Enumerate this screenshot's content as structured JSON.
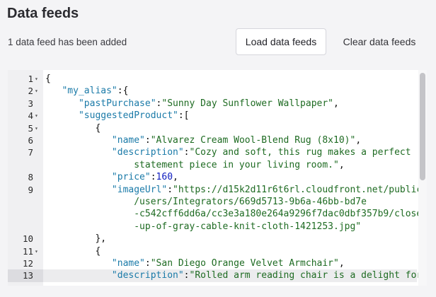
{
  "header": {
    "title": "Data feeds",
    "status": "1 data feed has been added",
    "load_button": "Load data feeds",
    "clear_button": "Clear data feeds"
  },
  "editor": {
    "lines": [
      {
        "num": "1",
        "fold": true,
        "parts": [
          {
            "t": "{",
            "c": "p"
          }
        ]
      },
      {
        "num": "2",
        "fold": true,
        "parts": [
          {
            "t": "   ",
            "c": "p"
          },
          {
            "t": "\"my_alias\"",
            "c": "k"
          },
          {
            "t": ":{",
            "c": "p"
          }
        ]
      },
      {
        "num": "3",
        "fold": false,
        "parts": [
          {
            "t": "      ",
            "c": "p"
          },
          {
            "t": "\"pastPurchase\"",
            "c": "k"
          },
          {
            "t": ":",
            "c": "p"
          },
          {
            "t": "\"Sunny Day Sunflower Wallpaper\"",
            "c": "s"
          },
          {
            "t": ",",
            "c": "p"
          }
        ]
      },
      {
        "num": "4",
        "fold": true,
        "parts": [
          {
            "t": "      ",
            "c": "p"
          },
          {
            "t": "\"suggestedProduct\"",
            "c": "k"
          },
          {
            "t": ":[",
            "c": "p"
          }
        ]
      },
      {
        "num": "5",
        "fold": true,
        "parts": [
          {
            "t": "         {",
            "c": "p"
          }
        ]
      },
      {
        "num": "6",
        "fold": false,
        "parts": [
          {
            "t": "            ",
            "c": "p"
          },
          {
            "t": "\"name\"",
            "c": "k"
          },
          {
            "t": ":",
            "c": "p"
          },
          {
            "t": "\"Alvarez Cream Wool-Blend Rug (8x10)\"",
            "c": "s"
          },
          {
            "t": ",",
            "c": "p"
          }
        ]
      },
      {
        "num": "7",
        "fold": false,
        "parts": [
          {
            "t": "            ",
            "c": "p"
          },
          {
            "t": "\"description\"",
            "c": "k"
          },
          {
            "t": ":",
            "c": "p"
          },
          {
            "t": "\"Cozy and soft, this rug makes a perfect",
            "c": "s"
          }
        ]
      },
      {
        "num": "",
        "fold": false,
        "parts": [
          {
            "t": "                statement piece in your living room.\"",
            "c": "s"
          },
          {
            "t": ",",
            "c": "p"
          }
        ]
      },
      {
        "num": "8",
        "fold": false,
        "parts": [
          {
            "t": "            ",
            "c": "p"
          },
          {
            "t": "\"price\"",
            "c": "k"
          },
          {
            "t": ":",
            "c": "p"
          },
          {
            "t": "160",
            "c": "n"
          },
          {
            "t": ",",
            "c": "p"
          }
        ]
      },
      {
        "num": "9",
        "fold": false,
        "parts": [
          {
            "t": "            ",
            "c": "p"
          },
          {
            "t": "\"imageUrl\"",
            "c": "k"
          },
          {
            "t": ":",
            "c": "p"
          },
          {
            "t": "\"https://d15k2d11r6t6rl.cloudfront.net/public",
            "c": "s"
          }
        ]
      },
      {
        "num": "",
        "fold": false,
        "parts": [
          {
            "t": "                /users/Integrators/669d5713-9b6a-46bb-bd7e",
            "c": "s"
          }
        ]
      },
      {
        "num": "",
        "fold": false,
        "parts": [
          {
            "t": "                -c542cff6dd6a/cc3e3a180e264a9296f7dac0dbf357b9/close",
            "c": "s"
          }
        ]
      },
      {
        "num": "",
        "fold": false,
        "parts": [
          {
            "t": "                -up-of-gray-cable-knit-cloth-1421253.jpg\"",
            "c": "s"
          }
        ]
      },
      {
        "num": "10",
        "fold": false,
        "parts": [
          {
            "t": "         },",
            "c": "p"
          }
        ]
      },
      {
        "num": "11",
        "fold": true,
        "parts": [
          {
            "t": "         {",
            "c": "p"
          }
        ]
      },
      {
        "num": "12",
        "fold": false,
        "parts": [
          {
            "t": "            ",
            "c": "p"
          },
          {
            "t": "\"name\"",
            "c": "k"
          },
          {
            "t": ":",
            "c": "p"
          },
          {
            "t": "\"San Diego Orange Velvet Armchair\"",
            "c": "s"
          },
          {
            "t": ",",
            "c": "p"
          }
        ]
      },
      {
        "num": "13",
        "fold": false,
        "parts": [
          {
            "t": "            ",
            "c": "p"
          },
          {
            "t": "\"description\"",
            "c": "k"
          },
          {
            "t": ":",
            "c": "p"
          },
          {
            "t": "\"Rolled arm reading chair is a delight for",
            "c": "s"
          }
        ]
      }
    ]
  },
  "icons": {
    "fold": "fold-arrow-icon"
  },
  "colors": {
    "key": "#1a7aa8",
    "string": "#1e6b22",
    "number": "#0d1bbf"
  }
}
